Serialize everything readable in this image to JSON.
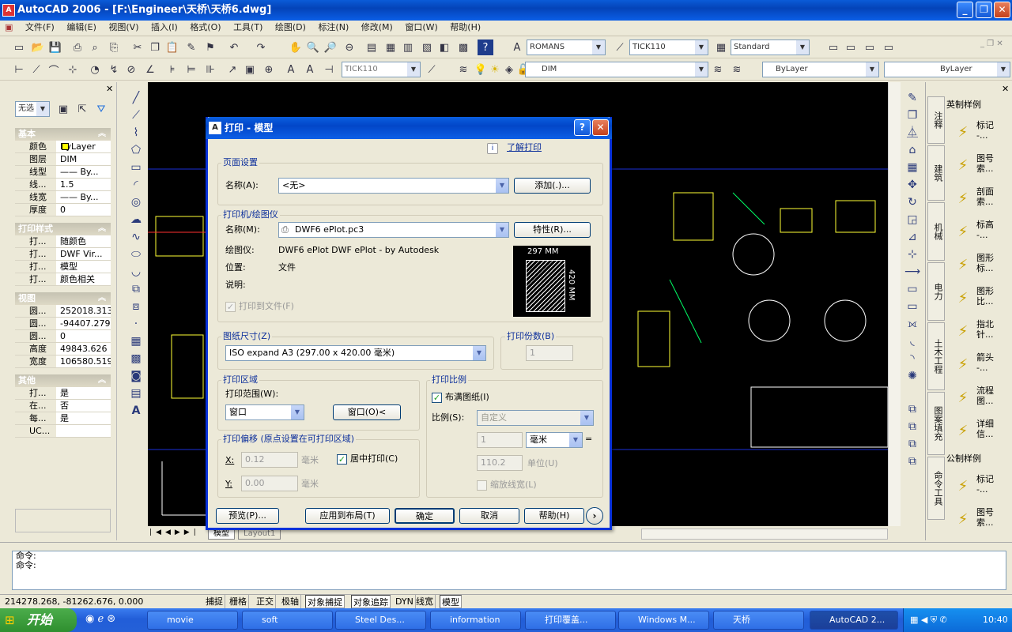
{
  "window": {
    "title": "AutoCAD 2006 - [F:\\Engineer\\天桥\\天桥6.dwg]",
    "icon": "A"
  },
  "menubar": [
    "文件(F)",
    "编辑(E)",
    "视图(V)",
    "插入(I)",
    "格式(O)",
    "工具(T)",
    "绘图(D)",
    "标注(N)",
    "修改(M)",
    "窗口(W)",
    "帮助(H)"
  ],
  "toolbar1": {
    "textstyle": "ROMANS",
    "dimstyle": "TICK110",
    "tablestyle": "Standard"
  },
  "toolbar2": {
    "dimstyle2": "TICK110",
    "layer": "DIM",
    "color": "ByLayer",
    "linetype": "ByLayer"
  },
  "props": {
    "selector": "无选",
    "sections": {
      "basic": "基本",
      "plot": "打印样式",
      "view": "视图",
      "misc": "其他"
    },
    "basic": [
      {
        "k": "颜色",
        "v": "ByLayer"
      },
      {
        "k": "图层",
        "v": "DIM"
      },
      {
        "k": "线型",
        "v": "—— By..."
      },
      {
        "k": "线...",
        "v": "1.5"
      },
      {
        "k": "线宽",
        "v": "—— By..."
      },
      {
        "k": "厚度",
        "v": "0"
      }
    ],
    "plot": [
      {
        "k": "打...",
        "v": "随颜色"
      },
      {
        "k": "打...",
        "v": "DWF Vir..."
      },
      {
        "k": "打...",
        "v": "模型"
      },
      {
        "k": "打...",
        "v": "颜色相关"
      }
    ],
    "view": [
      {
        "k": "圆...",
        "v": "252018.313"
      },
      {
        "k": "圆...",
        "v": "-94407.279"
      },
      {
        "k": "圆...",
        "v": "0"
      },
      {
        "k": "高度",
        "v": "49843.626"
      },
      {
        "k": "宽度",
        "v": "106580.519"
      }
    ],
    "misc": [
      {
        "k": "打...",
        "v": "是"
      },
      {
        "k": "在...",
        "v": "否"
      },
      {
        "k": "每...",
        "v": "是"
      },
      {
        "k": "UC...",
        "v": ""
      }
    ]
  },
  "layout_tabs": {
    "model": "模型",
    "layout1": "Layout1"
  },
  "palette": {
    "tabs": [
      "注释",
      "建筑",
      "机械",
      "电力",
      "土木工程",
      "图案填充",
      "命令工具"
    ],
    "header_imperial": "英制样例",
    "header_metric": "公制样例",
    "items": [
      {
        "t": "标记",
        "s": "-..."
      },
      {
        "t": "图号",
        "s": "索..."
      },
      {
        "t": "剖面",
        "s": "索..."
      },
      {
        "t": "标高",
        "s": "-..."
      },
      {
        "t": "图形",
        "s": "标..."
      },
      {
        "t": "图形",
        "s": "比..."
      },
      {
        "t": "指北",
        "s": "针..."
      },
      {
        "t": "箭头",
        "s": "-..."
      },
      {
        "t": "流程",
        "s": "图..."
      },
      {
        "t": "详细",
        "s": "信..."
      },
      {
        "t": "标记",
        "s": "-..."
      },
      {
        "t": "图号",
        "s": "索..."
      }
    ]
  },
  "command": {
    "line1": "命令:",
    "line2": "命令:"
  },
  "status": {
    "coords": "214278.268, -81262.676, 0.000",
    "buttons": [
      {
        "l": "捕捉",
        "on": false
      },
      {
        "l": "栅格",
        "on": false
      },
      {
        "l": "正交",
        "on": false
      },
      {
        "l": "极轴",
        "on": false
      },
      {
        "l": "对象捕捉",
        "on": true
      },
      {
        "l": "对象追踪",
        "on": true
      },
      {
        "l": "DYN",
        "on": false
      },
      {
        "l": "线宽",
        "on": false
      },
      {
        "l": "模型",
        "on": true
      }
    ]
  },
  "taskbar": {
    "start": "开始",
    "items": [
      "movie",
      "soft",
      "Steel Des...",
      "information",
      "打印覆盖...",
      "Windows M...",
      "天桥",
      "AutoCAD 2..."
    ],
    "clock": "10:40"
  },
  "dialog": {
    "title": "打印 - 模型",
    "learn_link": "了解打印",
    "page_setup": {
      "group": "页面设置",
      "name_label": "名称(A):",
      "name_value": "<无>",
      "add_btn": "添加(.)..."
    },
    "printer": {
      "group": "打印机/绘图仪",
      "name_label": "名称(M):",
      "name_value": "DWF6 ePlot.pc3",
      "props_btn": "特性(R)...",
      "plotter_label": "绘图仪:",
      "plotter_value": "DWF6 ePlot  DWF ePlot - by Autodesk",
      "where_label": "位置:",
      "where_value": "文件",
      "desc_label": "说明:",
      "plot_to_file": "打印到文件(F)",
      "preview_w": "297 MM",
      "preview_h": "420 MM"
    },
    "paper": {
      "group": "图纸尺寸(Z)",
      "value": "ISO expand A3 (297.00 x 420.00 毫米)"
    },
    "copies": {
      "group": "打印份数(B)",
      "value": "1"
    },
    "area": {
      "group": "打印区域",
      "range_label": "打印范围(W):",
      "range_value": "窗口",
      "window_btn": "窗口(O)<"
    },
    "scale": {
      "group": "打印比例",
      "fit": "布满图纸(I)",
      "scale_label": "比例(S):",
      "scale_value": "自定义",
      "v1": "1",
      "unit": "毫米",
      "v2": "110.2",
      "unit_label": "单位(U)",
      "lineweight": "缩放线宽(L)"
    },
    "offset": {
      "group": "打印偏移 (原点设置在可打印区域)",
      "x_label": "X:",
      "x_value": "0.12",
      "x_unit": "毫米",
      "center": "居中打印(C)",
      "y_label": "Y:",
      "y_value": "0.00",
      "y_unit": "毫米"
    },
    "buttons": {
      "preview": "预览(P)...",
      "apply": "应用到布局(T)",
      "ok": "确定",
      "cancel": "取消",
      "help": "帮助(H)"
    }
  }
}
